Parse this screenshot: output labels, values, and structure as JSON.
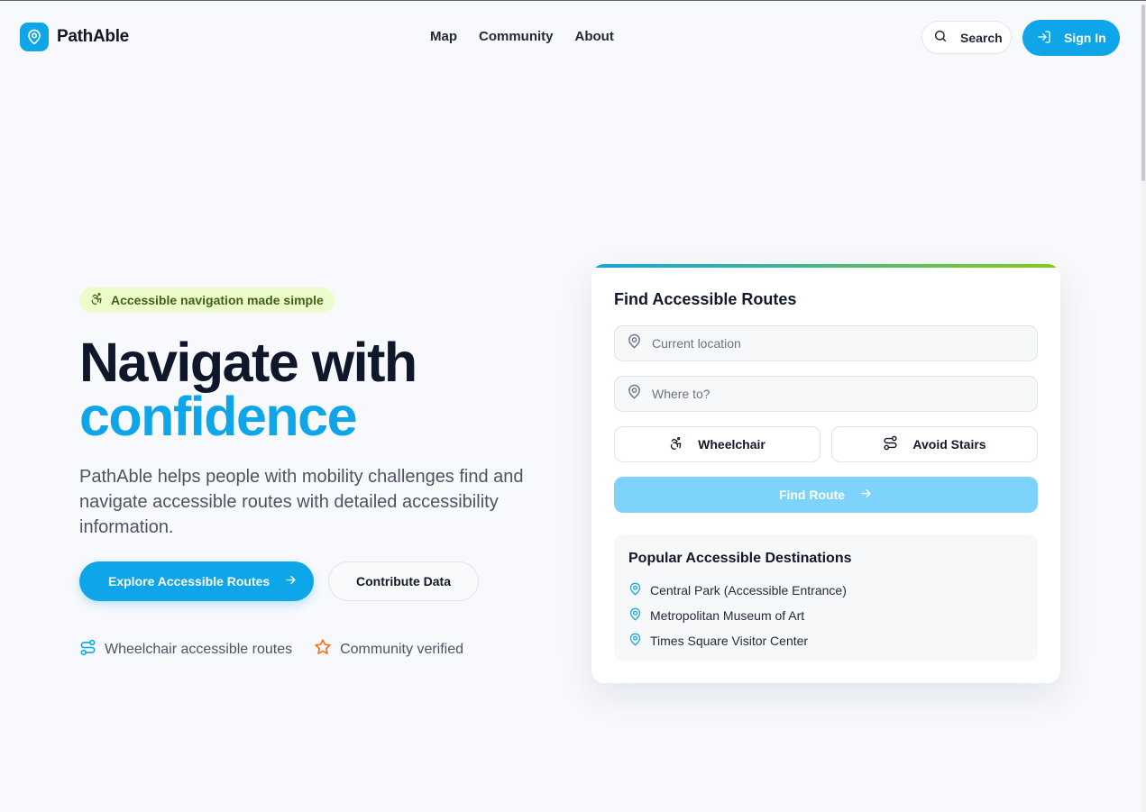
{
  "header": {
    "brand": "PathAble",
    "nav": [
      "Map",
      "Community",
      "About"
    ],
    "search_label": "Search",
    "signin_label": "Sign In"
  },
  "hero": {
    "badge": "Accessible navigation made simple",
    "title_line1": "Navigate with",
    "title_line2": "confidence",
    "description": "PathAble helps people with mobility challenges find and navigate accessible routes with detailed accessibility information.",
    "primary_cta": "Explore Accessible Routes",
    "secondary_cta": "Contribute Data",
    "features": [
      "Wheelchair accessible routes",
      "Community verified"
    ]
  },
  "route_card": {
    "title": "Find Accessible Routes",
    "from_placeholder": "Current location",
    "to_placeholder": "Where to?",
    "options": [
      "Wheelchair",
      "Avoid Stairs"
    ],
    "submit_label": "Find Route",
    "popular_title": "Popular Accessible Destinations",
    "destinations": [
      "Central Park (Accessible Entrance)",
      "Metropolitan Museum of Art",
      "Times Square Visitor Center"
    ]
  },
  "colors": {
    "primary": "#0ea5e9",
    "badge_bg": "#ecfccb",
    "badge_text": "#3f6212",
    "star": "#f97316",
    "disabled_button": "#7dd3fc"
  }
}
